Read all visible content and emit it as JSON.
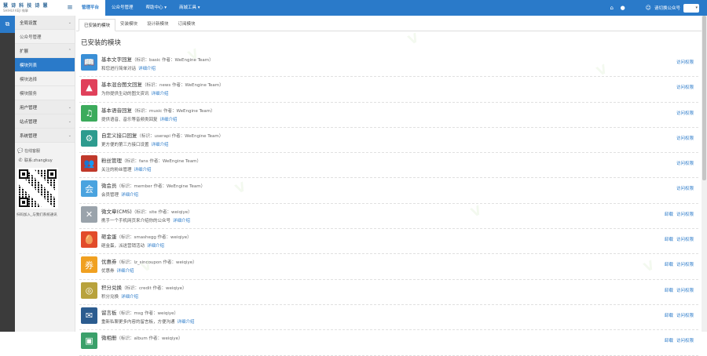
{
  "app": {
    "logo_main": "慧 诗 科 技 诗 慧",
    "logo_sub": "SHIHUI KEJI 微擎"
  },
  "topnav": {
    "tabs": [
      {
        "label": "管理平台"
      },
      {
        "label": "公众号管理"
      },
      {
        "label": "帮助中心 ▾"
      },
      {
        "label": "商城工具 ▾"
      }
    ],
    "account_name": "请切换公众号",
    "account_select": "▾"
  },
  "sidebar": {
    "items": [
      {
        "label": "全局设置",
        "kind": "group",
        "chev": "⌄"
      },
      {
        "label": "公众号管理",
        "kind": "sub"
      },
      {
        "label": "扩展",
        "kind": "group",
        "chev": "⌃"
      },
      {
        "label": "模块列表",
        "kind": "active"
      },
      {
        "label": "模块选择",
        "kind": "sub"
      },
      {
        "label": "模块服务",
        "kind": "sub"
      },
      {
        "label": "用户管理",
        "kind": "group",
        "chev": "⌄"
      },
      {
        "label": "站点管理",
        "kind": "group",
        "chev": "⌄"
      },
      {
        "label": "系统管理",
        "kind": "group",
        "chev": "⌄"
      }
    ],
    "contact": {
      "qq_label": "在线客服",
      "phone_label": "联系:zhangkuy"
    },
    "qr_caption": "扫码加入_与我们系统通讯"
  },
  "main": {
    "subtabs": [
      {
        "label": "已安装的模块",
        "active": true
      },
      {
        "label": "安装模块",
        "active": false
      },
      {
        "label": "设计新模块",
        "active": false
      },
      {
        "label": "订阅模块",
        "active": false
      }
    ],
    "section_title": "已安装的模块",
    "modules": [
      {
        "name": "基本文字回复",
        "meta": "（标识：basic  作者：WeEngine Team）",
        "desc": "和您进行简单对话",
        "detail": "详细介绍",
        "actions": [
          "访问权限"
        ],
        "color": "#3a8fd6",
        "icon": "📖"
      },
      {
        "name": "基本混合图文回复",
        "meta": "（标识：news  作者：WeEngine Team）",
        "desc": "为你提供生动的图文资讯",
        "detail": "详细介绍",
        "actions": [
          "访问权限"
        ],
        "color": "#e0405a",
        "icon": "▲"
      },
      {
        "name": "基本语音回复",
        "meta": "（标识：music  作者：WeEngine Team）",
        "desc": "提供语音、音乐等音频类回复",
        "detail": "详细介绍",
        "actions": [
          "访问权限"
        ],
        "color": "#3cab5c",
        "icon": "♫"
      },
      {
        "name": "自定义接口回复",
        "meta": "（标识：userapi  作者：WeEngine Team）",
        "desc": "更方便的第三方接口设置",
        "detail": "详细介绍",
        "actions": [
          "访问权限"
        ],
        "color": "#2d9b8e",
        "icon": "⚙"
      },
      {
        "name": "粉丝管理",
        "meta": "（标识：fans  作者：WeEngine Team）",
        "desc": "关注的粉丝管理",
        "detail": "详细介绍",
        "actions": [
          "访问权限"
        ],
        "color": "#c0392b",
        "icon": "👥"
      },
      {
        "name": "微会员",
        "meta": "（标识：member  作者：WeEngine Team）",
        "desc": "会员管理",
        "detail": "详细介绍",
        "actions": [
          "访问权限"
        ],
        "color": "#4aa3df",
        "icon": "会"
      },
      {
        "name": "微文章(CMS)",
        "meta": "（标识：site  作者：weiqiye）",
        "desc": "携手一个手机网页来介绍你的公众号",
        "detail": "详细介绍",
        "actions": [
          "卸载",
          "访问权限"
        ],
        "color": "#9aa3ab",
        "icon": "✕"
      },
      {
        "name": "砸金蛋",
        "meta": "（标识：smashegg  作者：weiqiye）",
        "desc": "砸金蛋，派送营销活动",
        "detail": "详细介绍",
        "actions": [
          "卸载",
          "访问权限"
        ],
        "color": "#e24b2a",
        "icon": "🥚"
      },
      {
        "name": "优惠券",
        "meta": "（标识：lz_sincoupon  作者：weiqiye）",
        "desc": "优惠券",
        "detail": "详细介绍",
        "actions": [
          "卸载",
          "访问权限"
        ],
        "color": "#f0a020",
        "icon": "券"
      },
      {
        "name": "积分兑换",
        "meta": "（标识：credit  作者：weiqiye）",
        "desc": "积分兑换",
        "detail": "详细介绍",
        "actions": [
          "卸载",
          "访问权限"
        ],
        "color": "#b8a23c",
        "icon": "◎"
      },
      {
        "name": "留言板",
        "meta": "（标识：msg  作者：weiqiye）",
        "desc": "重新私聊更多内容的留言板，方便沟通",
        "detail": "详细介绍",
        "actions": [
          "卸载",
          "访问权限"
        ],
        "color": "#2c5c8f",
        "icon": "✉"
      },
      {
        "name": "微相册",
        "meta": "（标识：album  作者：weiqiye）",
        "desc": "",
        "detail": "",
        "actions": [
          "卸载",
          "访问权限"
        ],
        "color": "#3aa06a",
        "icon": "▣"
      }
    ]
  }
}
